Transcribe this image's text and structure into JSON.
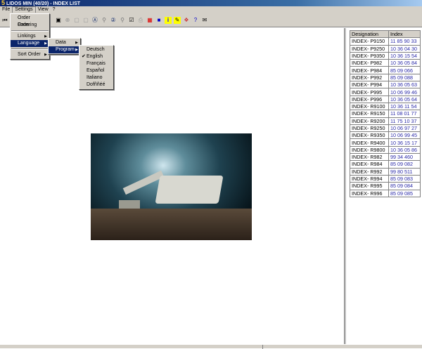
{
  "window": {
    "title": "LIDOS MIN (40/20) - INDEX LIST",
    "logo": "5"
  },
  "menubar": [
    "File",
    "Settings",
    "View",
    "?"
  ],
  "toolbar": {
    "icons": [
      "first-icon",
      "edit-icon",
      "zoom-in-icon",
      "page-icon",
      "page-alt-icon",
      "search-a-icon",
      "search-link-icon",
      "search-2-icon",
      "search-link-2-icon",
      "note-icon",
      "print-icon",
      "grid-icon",
      "blue-square-icon",
      "info-icon",
      "tools-icon",
      "bookmark-icon",
      "help-icon",
      "mail-icon"
    ]
  },
  "settings_menu": {
    "items": [
      "Order Form",
      "Ordering",
      "Linkings",
      "Language",
      "Sort Order"
    ]
  },
  "language_menu": {
    "items": [
      "Data",
      "Program"
    ]
  },
  "program_menu": {
    "items": [
      "Deutsch",
      "English",
      "Français",
      "Español",
      "Italiano",
      "Dofññéé"
    ],
    "checked": "English"
  },
  "table": {
    "headers": [
      "Designation",
      "Index"
    ],
    "rows": [
      [
        "INDEX- P9150",
        "11 85 90 33"
      ],
      [
        "INDEX- P9250",
        "10 36 04 30"
      ],
      [
        "INDEX- P9350",
        "10 36 15 54"
      ],
      [
        "INDEX- P982",
        "10 36 05 84"
      ],
      [
        "INDEX- P984",
        "85 09 066"
      ],
      [
        "INDEX- P992",
        "85 09 088"
      ],
      [
        "INDEX- P994",
        "10 36 05 63"
      ],
      [
        "INDEX- P995",
        "10 06 99 46"
      ],
      [
        "INDEX- P996",
        "10 36 05 64"
      ],
      [
        "INDEX- R9100",
        "10 36 11 54"
      ],
      [
        "INDEX- R9150",
        "11 08 01 77"
      ],
      [
        "INDEX- R9200",
        "11 75 10 37"
      ],
      [
        "INDEX- R9250",
        "10 06 97 27"
      ],
      [
        "INDEX- R9350",
        "10 06 99 45"
      ],
      [
        "INDEX- R9400",
        "10 36 15 17"
      ],
      [
        "INDEX- R9800",
        "10 36 05 86"
      ],
      [
        "INDEX- R982",
        "99 34 460"
      ],
      [
        "INDEX- R984",
        "85 09 082"
      ],
      [
        "INDEX- R992",
        "99 80 511"
      ],
      [
        "INDEX- R994",
        "85 09 083"
      ],
      [
        "INDEX- R995",
        "85 09 084"
      ],
      [
        "INDEX- R996",
        "85 09 085"
      ]
    ]
  },
  "colors": {
    "title_bar": "#0a246a",
    "menu_highlight": "#0a246a",
    "index_text": "#2a2aa8",
    "chrome": "#d4d0c8"
  }
}
